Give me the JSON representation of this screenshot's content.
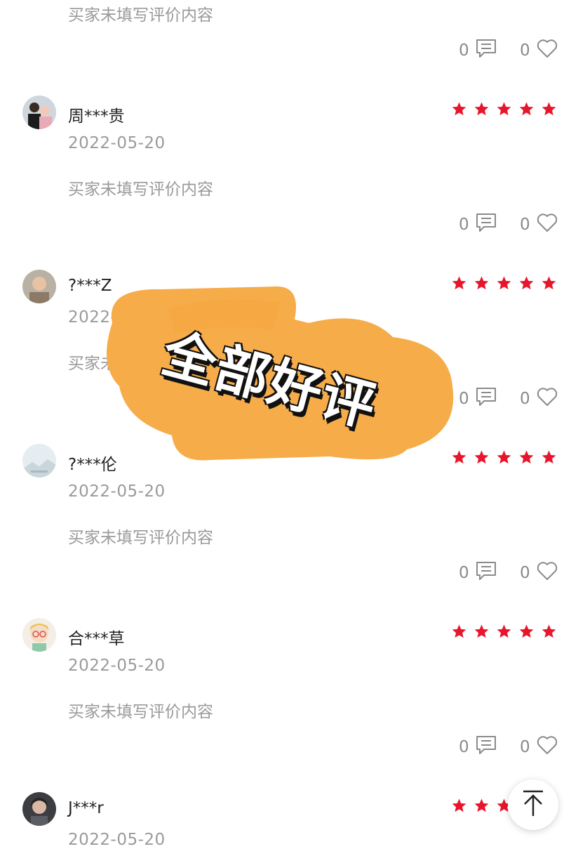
{
  "top_partial_review": {
    "content": "买家未填写评价内容",
    "comment_count": "0",
    "like_count": "0"
  },
  "reviews": [
    {
      "name": "周***贵",
      "date": "2022-05-20",
      "content": "买家未填写评价内容",
      "comment_count": "0",
      "like_count": "0",
      "rating": 5
    },
    {
      "name": "?***Z",
      "date": "2022-05-20",
      "content": "买家未填写评价内容",
      "comment_count": "0",
      "like_count": "0",
      "rating": 5
    },
    {
      "name": "?***伦",
      "date": "2022-05-20",
      "content": "买家未填写评价内容",
      "comment_count": "0",
      "like_count": "0",
      "rating": 5
    },
    {
      "name": "合***草",
      "date": "2022-05-20",
      "content": "买家未填写评价内容",
      "comment_count": "0",
      "like_count": "0",
      "rating": 5
    },
    {
      "name": "J***r",
      "date": "2022-05-20",
      "rating": 5
    }
  ],
  "overlay": {
    "sticker_text": "全部好评"
  },
  "colors": {
    "star": "#e8162c",
    "sticker": "#f7ac4a",
    "muted_text": "#9a9a9a"
  },
  "icons": {
    "comment": "comment-icon",
    "like": "heart-icon",
    "star": "star-icon",
    "scroll_top": "arrow-up-to-top-icon"
  }
}
